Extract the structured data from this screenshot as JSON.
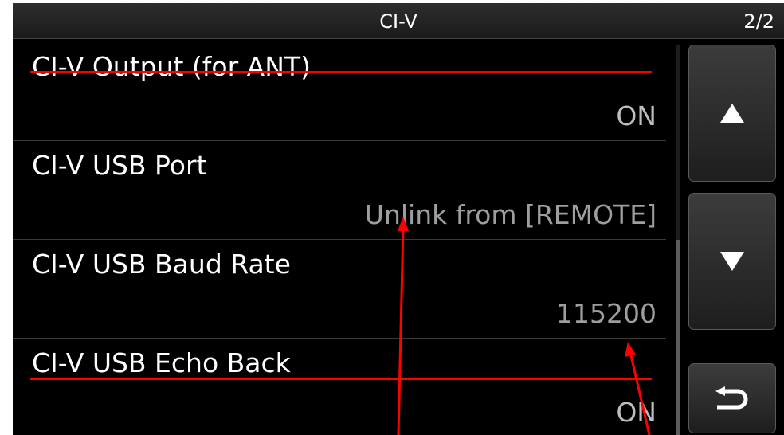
{
  "title_bar": {
    "title": "CI-V",
    "page": "2/2"
  },
  "rows": [
    {
      "label": "CI-V Output (for ANT)",
      "value": "ON",
      "struck": true
    },
    {
      "label": "CI-V USB Port",
      "value": "Unlink from [REMOTE]",
      "struck": false
    },
    {
      "label": "CI-V USB Baud Rate",
      "value": "115200",
      "struck": false
    },
    {
      "label": "CI-V USB Echo Back",
      "value": "ON",
      "struck": true
    }
  ],
  "side_buttons": {
    "up_icon": "up-triangle-icon",
    "down_icon": "down-triangle-icon",
    "back_icon": "return-arrow-icon"
  },
  "annotation_colors": {
    "strike": "#ff0000",
    "arrow": "#ff0000"
  }
}
